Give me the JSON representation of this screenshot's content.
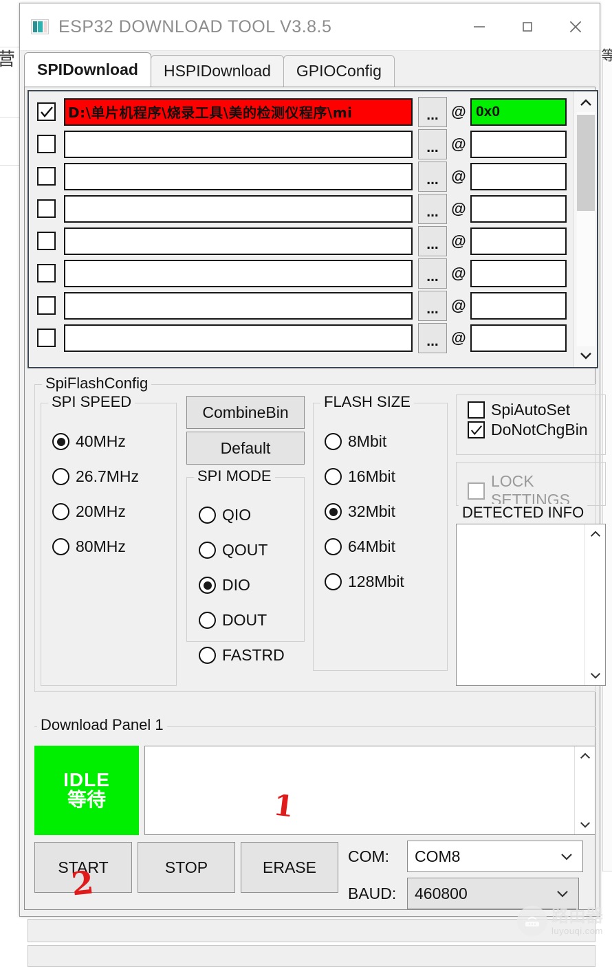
{
  "window": {
    "title": "ESP32 DOWNLOAD TOOL V3.8.5",
    "icon": "app-icon",
    "minimize_label": "–",
    "maximize_label": "□",
    "close_label": "✕"
  },
  "tabs": [
    {
      "label": "SPIDownload",
      "active": true
    },
    {
      "label": "HSPIDownload",
      "active": false
    },
    {
      "label": "GPIOConfig",
      "active": false
    }
  ],
  "file_list": {
    "browse_label": "...",
    "at_symbol": "@",
    "rows": [
      {
        "checked": true,
        "path": "D:\\单片机程序\\烧录工具\\美的检测仪程序\\mi",
        "address": "0x0",
        "highlight": true
      },
      {
        "checked": false,
        "path": "",
        "address": "",
        "highlight": false
      },
      {
        "checked": false,
        "path": "",
        "address": "",
        "highlight": false
      },
      {
        "checked": false,
        "path": "",
        "address": "",
        "highlight": false
      },
      {
        "checked": false,
        "path": "",
        "address": "",
        "highlight": false
      },
      {
        "checked": false,
        "path": "",
        "address": "",
        "highlight": false
      },
      {
        "checked": false,
        "path": "",
        "address": "",
        "highlight": false
      },
      {
        "checked": false,
        "path": "",
        "address": "",
        "highlight": false
      }
    ]
  },
  "spi_flash_config": {
    "title": "SpiFlashConfig",
    "spi_speed": {
      "title": "SPI SPEED",
      "options": [
        {
          "label": "40MHz",
          "selected": true
        },
        {
          "label": "26.7MHz",
          "selected": false
        },
        {
          "label": "20MHz",
          "selected": false
        },
        {
          "label": "80MHz",
          "selected": false
        }
      ]
    },
    "combine_bin_label": "CombineBin",
    "default_label": "Default",
    "spi_mode": {
      "title": "SPI MODE",
      "options": [
        {
          "label": "QIO",
          "selected": false
        },
        {
          "label": "QOUT",
          "selected": false
        },
        {
          "label": "DIO",
          "selected": true
        },
        {
          "label": "DOUT",
          "selected": false
        },
        {
          "label": "FASTRD",
          "selected": false
        }
      ]
    },
    "flash_size": {
      "title": "FLASH SIZE",
      "options": [
        {
          "label": "8Mbit",
          "selected": false
        },
        {
          "label": "16Mbit",
          "selected": false
        },
        {
          "label": "32Mbit",
          "selected": true
        },
        {
          "label": "64Mbit",
          "selected": false
        },
        {
          "label": "128Mbit",
          "selected": false
        }
      ]
    },
    "checkboxes": [
      {
        "label": "SpiAutoSet",
        "checked": false,
        "disabled": false
      },
      {
        "label": "DoNotChgBin",
        "checked": true,
        "disabled": false
      }
    ],
    "lock_settings": {
      "label": "LOCK SETTINGS",
      "checked": false,
      "disabled": true
    },
    "detected_info": {
      "title": "DETECTED INFO",
      "content": ""
    }
  },
  "download_panel": {
    "title": "Download Panel 1",
    "status_en": "IDLE",
    "status_cn": "等待",
    "status_color": "#00ee00",
    "log": "",
    "buttons": [
      {
        "label": "START"
      },
      {
        "label": "STOP"
      },
      {
        "label": "ERASE"
      }
    ],
    "com_label": "COM:",
    "com_value": "COM8",
    "baud_label": "BAUD:",
    "baud_value": "460800"
  },
  "annotations": [
    {
      "text": "1"
    },
    {
      "text": "2"
    }
  ],
  "watermark": {
    "cn": "路由器",
    "en": "luyouqi.com"
  },
  "background": {
    "left_char": "营",
    "right_chars": "等"
  }
}
